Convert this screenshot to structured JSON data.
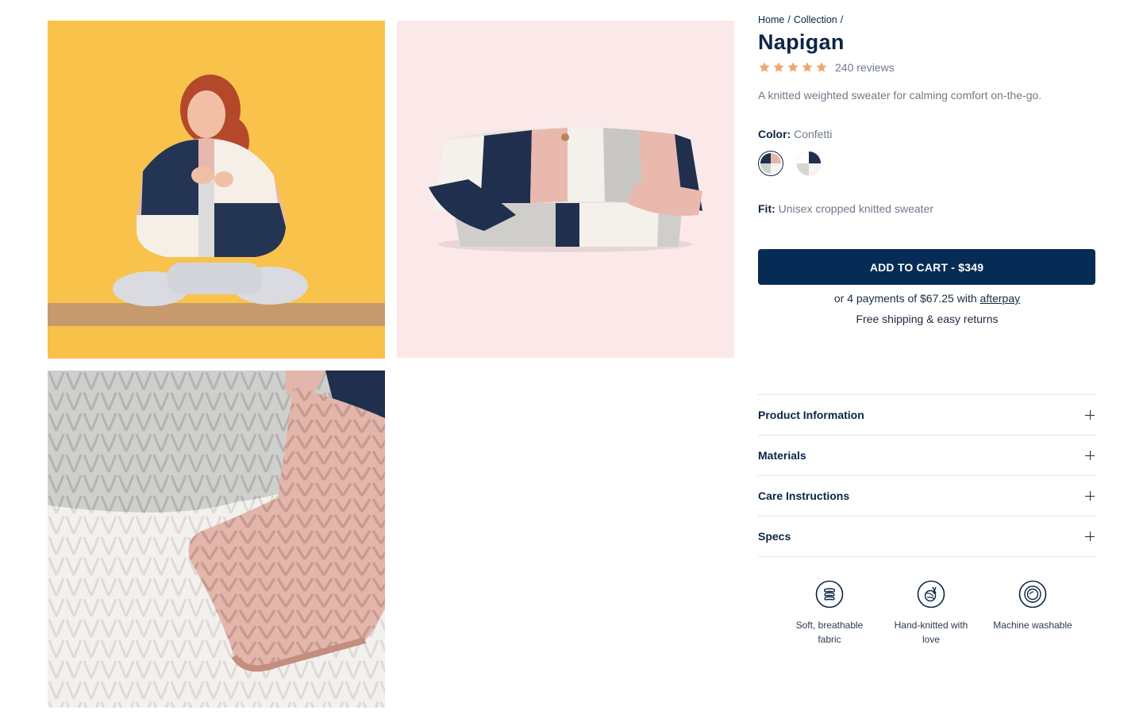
{
  "breadcrumb": {
    "home": "Home",
    "sep1": "/",
    "collection": "Collection",
    "sep2": "/"
  },
  "product": {
    "title": "Napigan",
    "rating": 5,
    "reviews": "240 reviews",
    "description": "A knitted weighted sweater for calming comfort on-the-go."
  },
  "color": {
    "label": "Color:",
    "value": "Confetti"
  },
  "fit": {
    "label": "Fit:",
    "value": "Unisex cropped knitted sweater"
  },
  "cart": {
    "button_label": "ADD TO CART - $349",
    "afterpay_prefix": "or 4 payments of $67.25 with",
    "afterpay_link": "afterpay",
    "shipping": "Free shipping & easy returns"
  },
  "accordion": [
    {
      "title": "Product Information"
    },
    {
      "title": "Materials"
    },
    {
      "title": "Care Instructions"
    },
    {
      "title": "Specs"
    }
  ],
  "features": [
    {
      "icon": "fabric-icon",
      "text": "Soft, breathable fabric"
    },
    {
      "icon": "yarn-ball-icon",
      "text": "Hand-knitted with love"
    },
    {
      "icon": "washing-machine-icon",
      "text": "Machine washable"
    }
  ],
  "colors": {
    "navy": "#062c55",
    "star": "#f3a56b",
    "muted_text": "#6f7a89"
  }
}
